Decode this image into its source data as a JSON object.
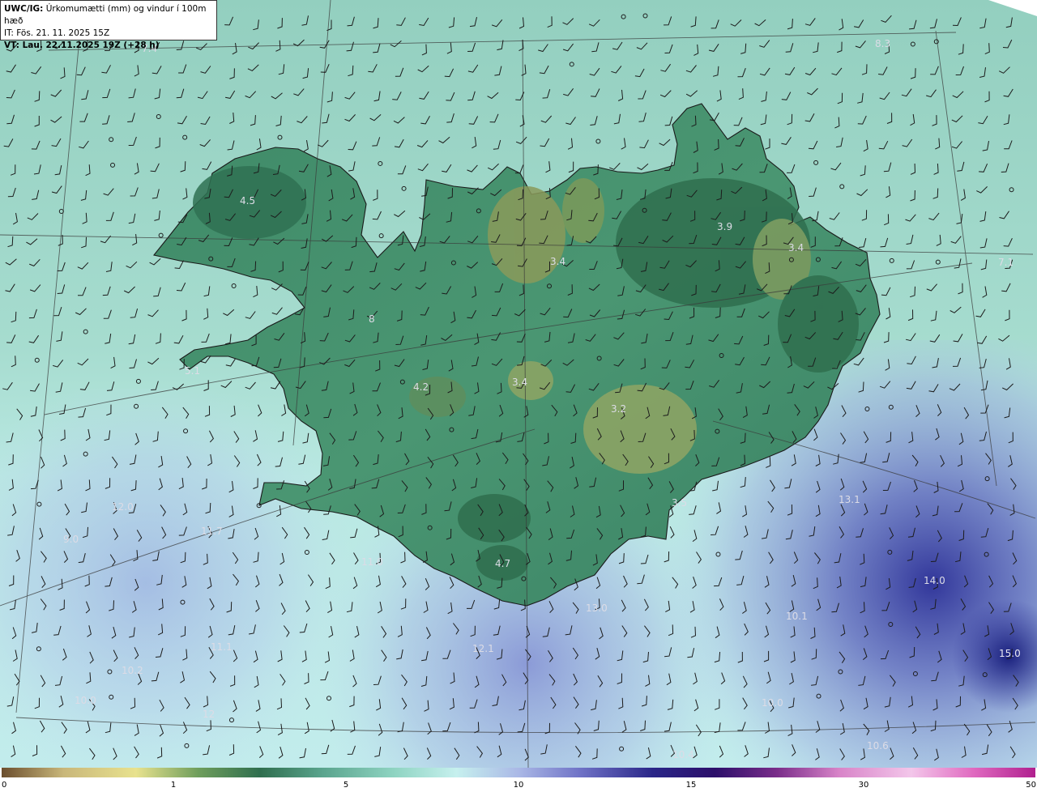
{
  "header": {
    "product_bold": "UWC/IG:",
    "product_desc": " Úrkomumætti (mm) og vindur í 100m hæð",
    "init_time": "IT: Fös. 21. 11. 2025 15Z",
    "valid_time": "VT: Lau. 22.11.2025 19Z (+28 h)"
  },
  "value_labels": [
    {
      "text": "7.4"
    },
    {
      "text": "8.3"
    },
    {
      "text": "4.5"
    },
    {
      "text": "3.4"
    },
    {
      "text": "3.9"
    },
    {
      "text": "3.4"
    },
    {
      "text": "7.1"
    },
    {
      "text": "8"
    },
    {
      "text": "5.1"
    },
    {
      "text": "4.2"
    },
    {
      "text": "3.4"
    },
    {
      "text": "3.2"
    },
    {
      "text": "3.5"
    },
    {
      "text": "4.7"
    },
    {
      "text": "13.1"
    },
    {
      "text": "14.0"
    },
    {
      "text": "13.0"
    },
    {
      "text": "12.1"
    },
    {
      "text": "10.1"
    },
    {
      "text": "15.0"
    },
    {
      "text": "12.0"
    },
    {
      "text": "11.7"
    },
    {
      "text": "9.0"
    },
    {
      "text": "11.0"
    },
    {
      "text": "10.2"
    },
    {
      "text": "11.1"
    },
    {
      "text": "10.0"
    },
    {
      "text": "12"
    },
    {
      "text": "10.0"
    },
    {
      "text": "10.6"
    },
    {
      "text": "10.4"
    }
  ],
  "colorbar": {
    "ticks": [
      "0",
      "1",
      "5",
      "10",
      "15",
      "30",
      "50"
    ],
    "colors": [
      "#6b4e2e",
      "#c9b77a",
      "#e8e28e",
      "#6f9e5c",
      "#2f6e4e",
      "#5aa48d",
      "#8fd4c2",
      "#c6f0ee",
      "#aab8e6",
      "#6f72c6",
      "#2a2688",
      "#2c0f6a",
      "#7a2d8a",
      "#d884c8",
      "#f3c6ea",
      "#e06ac0",
      "#b0208e"
    ]
  }
}
